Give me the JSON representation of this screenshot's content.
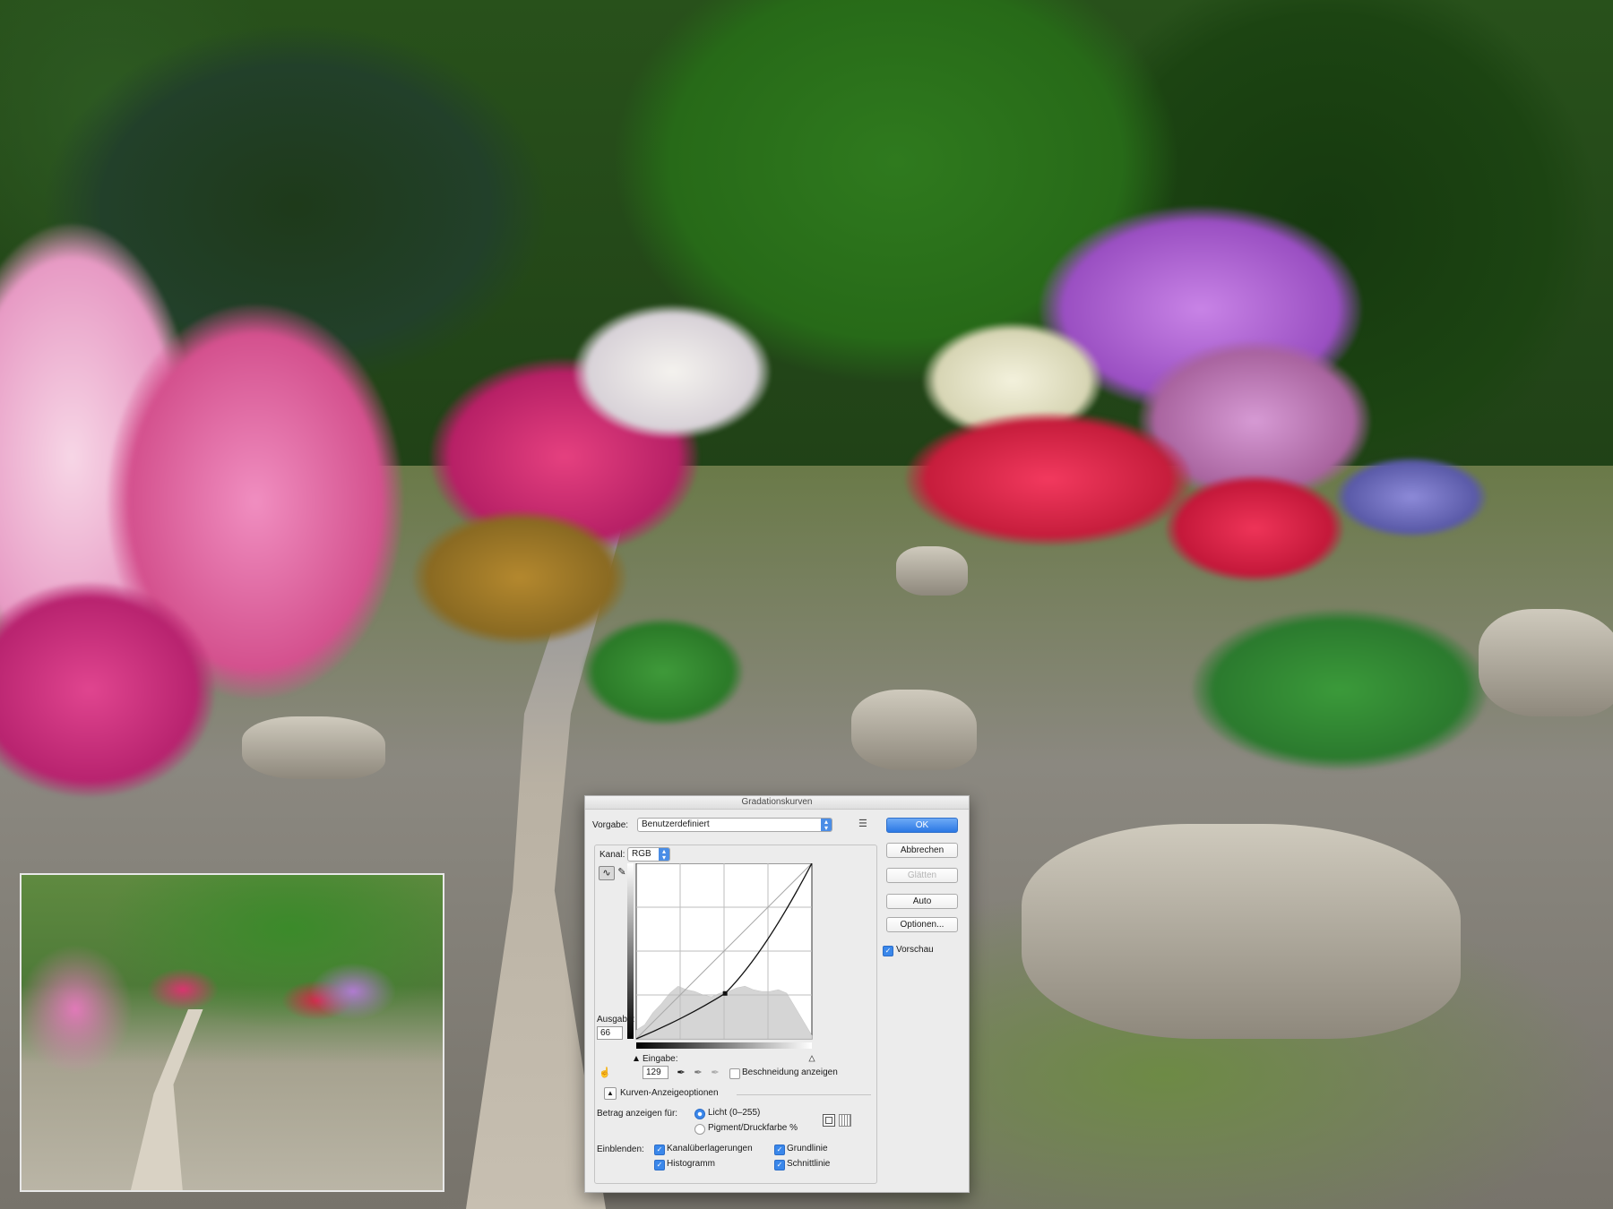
{
  "dialog": {
    "title": "Gradationskurven",
    "preset_label": "Vorgabe:",
    "preset_value": "Benutzerdefiniert",
    "channel_label": "Kanal:",
    "channel_value": "RGB",
    "output_label": "Ausgabe:",
    "output_value": "66",
    "input_label": "Eingabe:",
    "input_value": "129",
    "show_clipping_label": "Beschneidung anzeigen",
    "curve_options_label": "Kurven-Anzeigeoptionen",
    "show_amount_label": "Betrag anzeigen für:",
    "light_label": "Licht (0–255)",
    "pigment_label": "Pigment/Druckfarbe %",
    "show_label": "Einblenden:",
    "channel_overlays_label": "Kanalüberlagerungen",
    "baseline_label": "Grundlinie",
    "histogram_label": "Histogramm",
    "intersection_label": "Schnittlinie",
    "buttons": {
      "ok": "OK",
      "cancel": "Abbrechen",
      "smooth": "Glätten",
      "auto": "Auto",
      "options": "Optionen..."
    },
    "preview_label": "Vorschau",
    "states": {
      "preview_checked": true,
      "show_clipping_checked": false,
      "light_selected": true,
      "channel_overlays_checked": true,
      "baseline_checked": true,
      "histogram_checked": true,
      "intersection_checked": true
    }
  },
  "curve": {
    "point_input": 129,
    "point_output": 66,
    "range": [
      0,
      255
    ]
  }
}
